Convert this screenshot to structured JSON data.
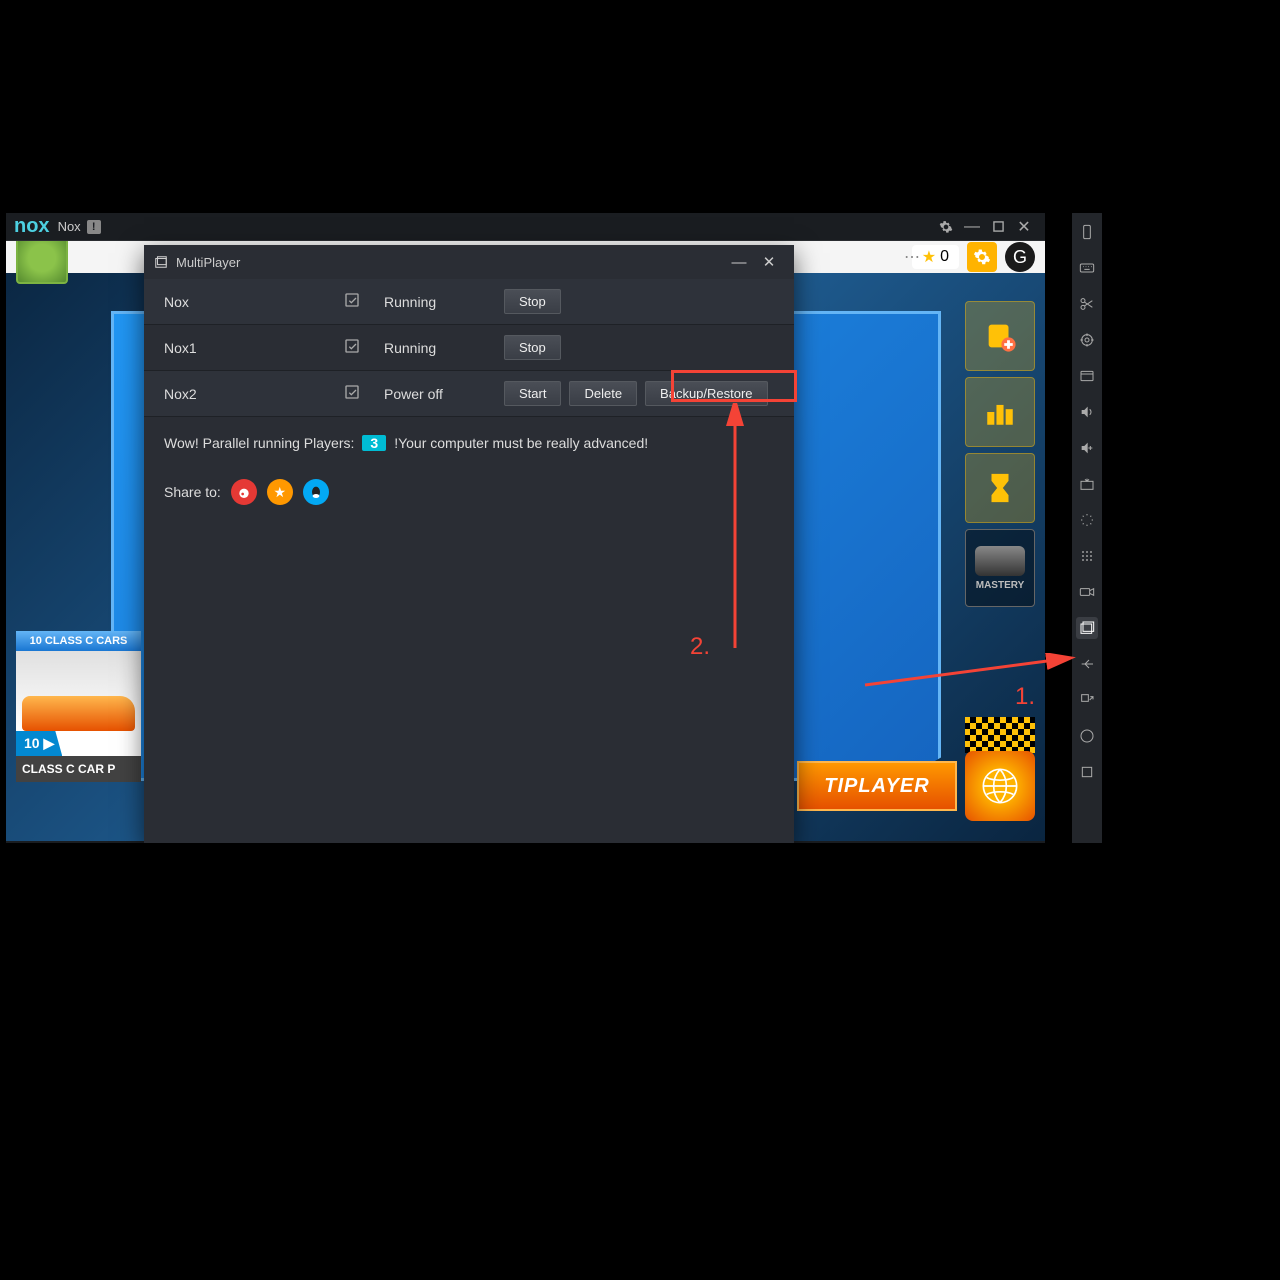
{
  "titlebar": {
    "logo": "nox",
    "title": "Nox",
    "badge": "!"
  },
  "game": {
    "star_count": "0",
    "class_card_head": "10 CLASS C CARS",
    "class_card_badge": "10",
    "class_card_arrow": "▶",
    "class_card_foot": "CLASS C CAR P",
    "side_mastery": "MASTERY",
    "multiplayer_text": "TIPLAYER"
  },
  "dialog": {
    "title": "MultiPlayer",
    "rows": [
      {
        "name": "Nox",
        "status": "Running",
        "buttons": [
          "Stop"
        ]
      },
      {
        "name": "Nox1",
        "status": "Running",
        "buttons": [
          "Stop"
        ]
      },
      {
        "name": "Nox2",
        "status": "Power off",
        "buttons": [
          "Start",
          "Delete",
          "Backup/Restore"
        ]
      }
    ],
    "parallel_msg_prefix": "Wow! Parallel running Players:",
    "parallel_count": "3",
    "parallel_msg_suffix": "!Your computer must be really advanced!",
    "share_label": "Share to:"
  },
  "annotations": {
    "one": "1.",
    "two": "2."
  }
}
